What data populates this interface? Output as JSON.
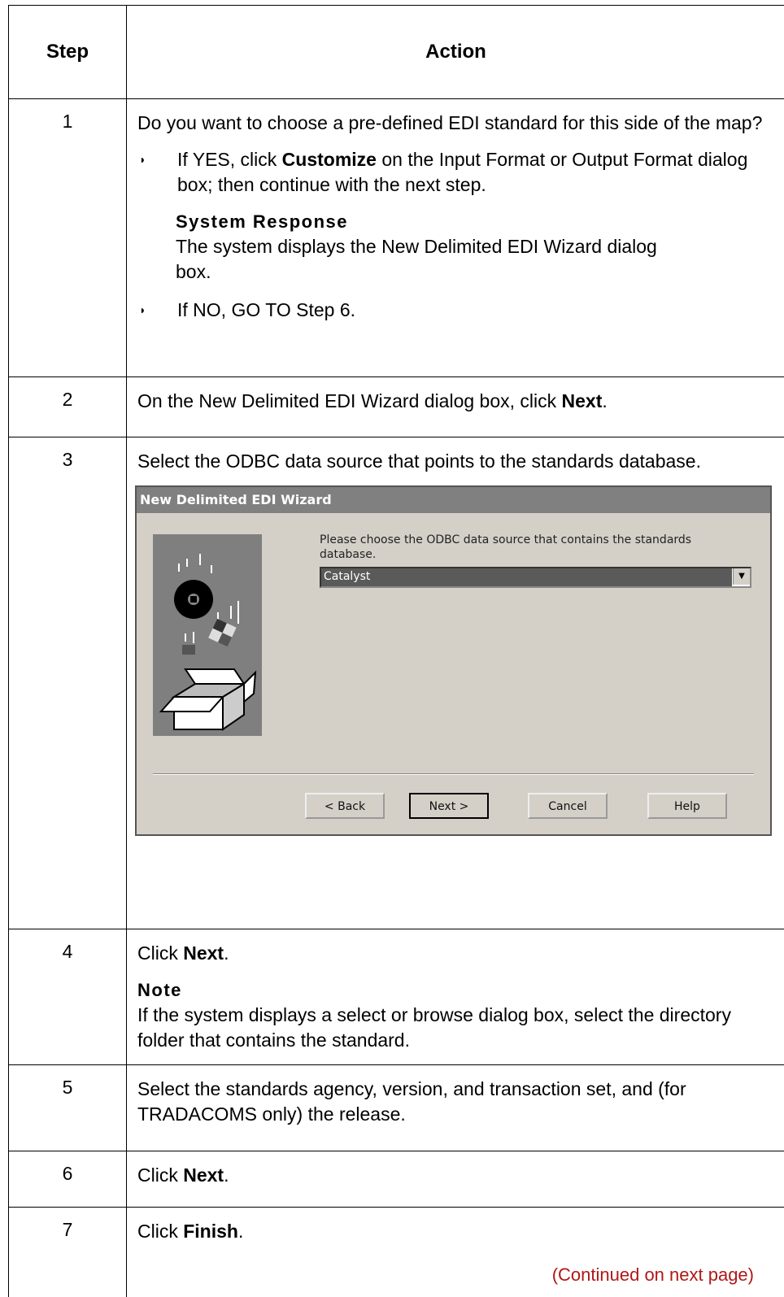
{
  "table": {
    "header": {
      "step": "Step",
      "action": "Action"
    },
    "rows": [
      {
        "step": "1",
        "intro": "Do you want to choose a pre-defined EDI standard for this side of the map?",
        "yes_pre": "If YES, click ",
        "yes_bold": "Customize",
        "yes_post": " on the Input Format or Output Format dialog box; then continue with the next step.",
        "response_heading": "System Response",
        "response_text": "The system displays the New Delimited EDI Wizard dialog box.",
        "no_text": "If NO, GO TO Step 6."
      },
      {
        "step": "2",
        "pre": "On the New Delimited EDI Wizard dialog box, click ",
        "bold": "Next",
        "post": "."
      },
      {
        "step": "3",
        "text": "Select the ODBC data source that points to the standards database."
      },
      {
        "step": "4",
        "pre": "Click ",
        "bold": "Next",
        "post": ".",
        "note_heading": "Note",
        "note_text": "If the system displays a select or browse dialog box, select the directory folder that contains the standard."
      },
      {
        "step": "5",
        "text": "Select the standards agency, version, and transaction set, and (for TRADACOMS only) the release."
      },
      {
        "step": "6",
        "pre": "Click ",
        "bold": "Next",
        "post": "."
      },
      {
        "step": "7",
        "pre": "Click ",
        "bold": "Finish",
        "post": ".",
        "continued": "(Continued on next page)"
      }
    ]
  },
  "dialog": {
    "title": "New Delimited EDI Wizard",
    "prompt": "Please choose the ODBC data source that contains the standards database.",
    "selected_source": "Catalyst",
    "buttons": {
      "back": "< Back",
      "next": "Next >",
      "cancel": "Cancel",
      "help": "Help"
    }
  }
}
